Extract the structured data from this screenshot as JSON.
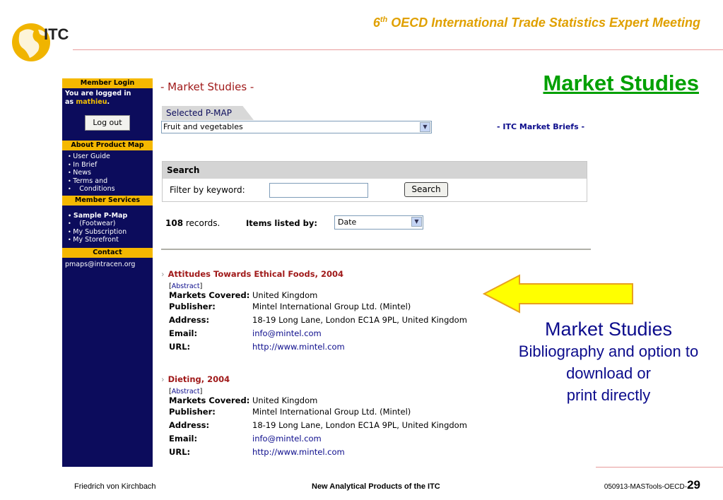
{
  "slide": {
    "logo_text": "ITC",
    "conference": {
      "prefix": "6",
      "sup": "th",
      "rest": " OECD International Trade Statistics Expert Meeting"
    },
    "title": "Market Studies",
    "footer": {
      "left": "Friedrich von Kirchbach",
      "center": "New Analytical Products of the ITC",
      "right": "050913-MASTools-OECD-",
      "page": "29"
    },
    "callout": {
      "title": "Market Studies",
      "lines": [
        "Bibliography and option to",
        "download or",
        "print directly"
      ]
    }
  },
  "colors": {
    "accent_orange": "#e0a000",
    "sidebar_bg": "#0c0c5c",
    "sidebar_head": "#f5b800",
    "link": "#0c0c8c",
    "title_green": "#00a000",
    "record_title": "#a01a1a"
  },
  "sidebar": {
    "login_head": "Member Login",
    "logged_prefix": "You are logged in",
    "logged_as": "as ",
    "username": "mathieu",
    "username_suffix": ".",
    "logout_label": "Log out",
    "about_head": "About Product Map",
    "about_items": [
      "User Guide",
      "In Brief",
      "News",
      "Terms and",
      "Conditions"
    ],
    "services_head": "Member Services",
    "services_items": [
      "Sample P-Map",
      "(Footwear)",
      "My Subscription",
      "My Storefront"
    ],
    "contact_head": "Contact",
    "contact_email": "pmaps@intracen.org"
  },
  "page": {
    "heading": "- Market Studies -",
    "tab_label": "Selected P-MAP",
    "pmap_selected": "Fruit and vegetables",
    "briefs_link": "- ITC Market Briefs -",
    "search_head": "Search",
    "filter_label": "Filter by keyword:",
    "keyword_value": "",
    "search_button": "Search",
    "records_count": "108",
    "records_suffix": " records.",
    "items_listed_label": "Items listed by:",
    "sort_selected": "Date"
  },
  "records": [
    {
      "title": "Attitudes Towards Ethical Foods, 2004",
      "abstract": "Abstract",
      "markets_label": "Markets Covered:",
      "markets": "United Kingdom",
      "publisher_label": "Publisher:",
      "publisher": "Mintel International Group Ltd. (Mintel)",
      "address_label": "Address:",
      "address": "18-19 Long Lane, London EC1A 9PL, United Kingdom",
      "email_label": "Email:",
      "email": "info@mintel.com",
      "url_label": "URL:",
      "url": "http://www.mintel.com"
    },
    {
      "title": "Dieting, 2004",
      "abstract": "Abstract",
      "markets_label": "Markets Covered:",
      "markets": "United Kingdom",
      "publisher_label": "Publisher:",
      "publisher": "Mintel International Group Ltd. (Mintel)",
      "address_label": "Address:",
      "address": "18-19 Long Lane, London EC1A 9PL, United Kingdom",
      "email_label": "Email:",
      "email": "info@mintel.com",
      "url_label": "URL:",
      "url": "http://www.mintel.com"
    }
  ]
}
